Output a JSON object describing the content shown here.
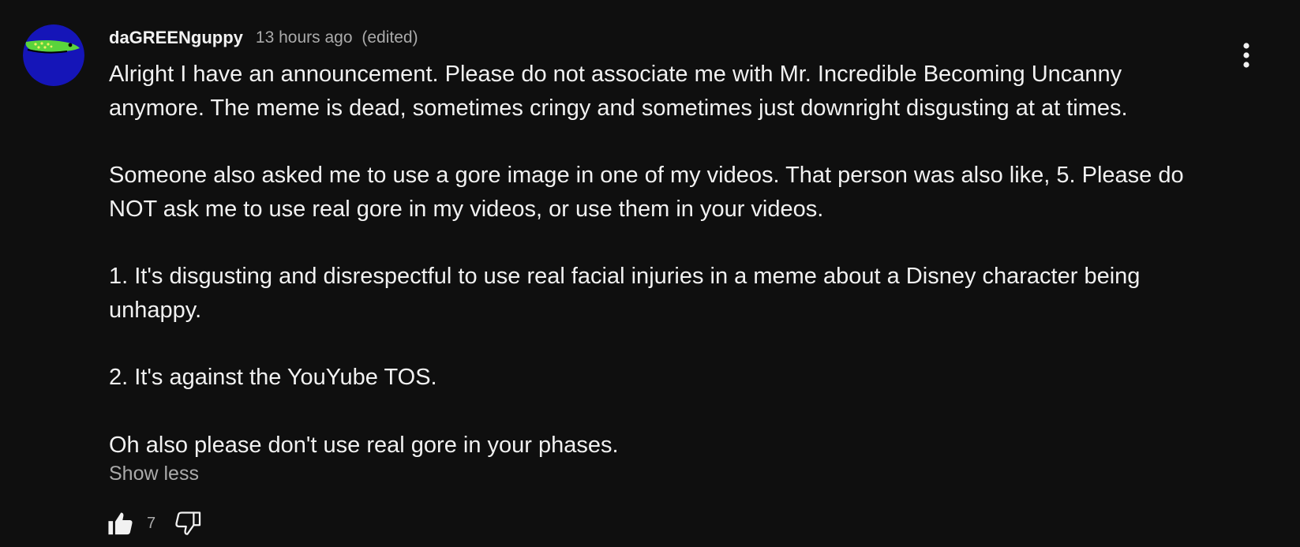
{
  "comment": {
    "author": "daGREENguppy",
    "timestamp": "13 hours ago",
    "edited_label": "(edited)",
    "avatar_icon": "green-fish-avatar",
    "menu_icon": "vertical-ellipsis-icon",
    "paragraphs": [
      "Alright I have an announcement. Please do not associate me with Mr. Incredible Becoming Uncanny anymore. The meme is dead, sometimes cringy and sometimes just downright disgusting at at times.",
      "Someone also asked me to use a gore image in one of my videos. That person was also like, 5. Please do NOT ask me to use real gore in my videos, or use them in your videos.",
      "1. It's disgusting and disrespectful to use real facial injuries in a meme about a Disney character being unhappy.",
      "2. It's against the YouYube TOS.",
      "Oh also please don't use real gore in your phases."
    ],
    "show_less_label": "Show less",
    "like_count": "7",
    "like_icon": "thumbs-up-icon",
    "dislike_icon": "thumbs-down-icon"
  },
  "colors": {
    "background": "#0f0f0f",
    "primary_text": "#f1f1f1",
    "secondary_text": "#aaaaaa",
    "avatar_blue": "#1515b8",
    "avatar_green": "#5ad43c"
  }
}
